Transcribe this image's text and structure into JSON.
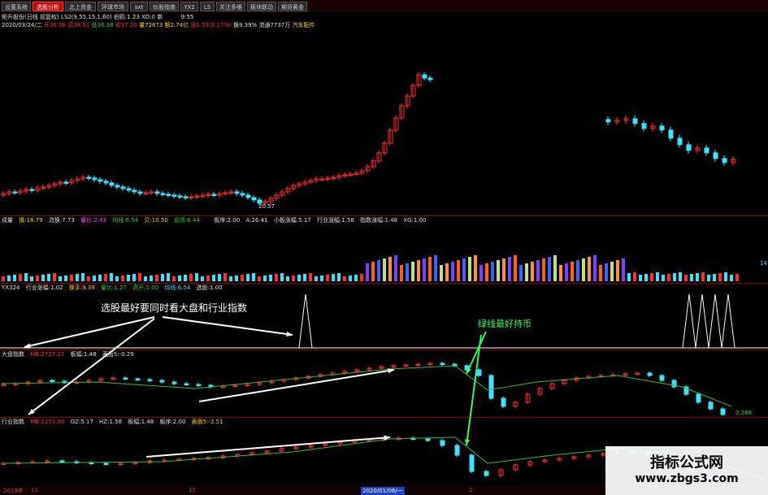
{
  "tabs": [
    "设置系统",
    "选股分析",
    "北上资金",
    "环球市场",
    "sxt",
    "炒股指南",
    "YX2",
    "LS",
    "关注多维",
    "板块联动",
    "期货黄金"
  ],
  "tab_active": 1,
  "info_line1": {
    "stock": "矩升股份(日线 前复权)",
    "ma": "LS2(9,55,15,1,60) 伯鸥:1.23 XD:0 新",
    "time": "9:55"
  },
  "info_line2": {
    "date": "2020/03/24/二",
    "open": "开36.58",
    "high": "高38.91",
    "low": "低36.38",
    "close": "收37.20",
    "vol": "量72673",
    "amount": "额2.74亿",
    "pct": "涨1.03(3.17%)",
    "turn": "换9.39%",
    "cap": "流通7737万",
    "sector": "汽车配件"
  },
  "price_low_label": "20.57",
  "vol_head": {
    "name": "成量",
    "turn": "换:18.79",
    "rate": "流换:7.73",
    "vratio": "量比:2.43",
    "ma1": "均线:6.54",
    "ma2": "贝:10.50",
    "ma3": "前资:6.44"
  },
  "vol_head2": {
    "a": "板序:2.00",
    "b": "A:26.41",
    "c": "小板涨幅:5.17",
    "d": "行业涨幅:1.58",
    "e": "指数涨幅:1.48",
    "f": "XG:1.00"
  },
  "vol_right_value": "14",
  "yx_head": {
    "name": "YX324",
    "a": "行业涨幅:1.02",
    "b": "换手:9.39",
    "c": "量比:1.27",
    "d": "高开:1.00",
    "e": "均线:6.54",
    "f": "选股:1.00"
  },
  "market_head": {
    "name": "大盘指数",
    "a": "MB:2727.27",
    "b": "板幅:1.48",
    "c": "表面5:-0.29"
  },
  "market_right_value": "0.288",
  "industry_head": {
    "name": "行业指数",
    "a": "MB:1253.90",
    "b": "GZ:5.17",
    "c": "HZ:1.58",
    "d": "板幅:1.48",
    "e": "板序:2.00",
    "f": "表面5:-2.51"
  },
  "annotations": {
    "main": "选股最好要同时看大盘和行业指数",
    "green": "绿线最好持币"
  },
  "xaxis": {
    "a": "2019年",
    "b": "11",
    "c": "12",
    "d": "2020/01/06/一",
    "e": "2"
  },
  "watermark": {
    "line1": "指标公式网",
    "line2": "www.zbgs3.com"
  },
  "colors": {
    "up": "#ff3030",
    "down": "#40e0ff",
    "bg": "#000000",
    "grid": "#8a0000"
  }
}
